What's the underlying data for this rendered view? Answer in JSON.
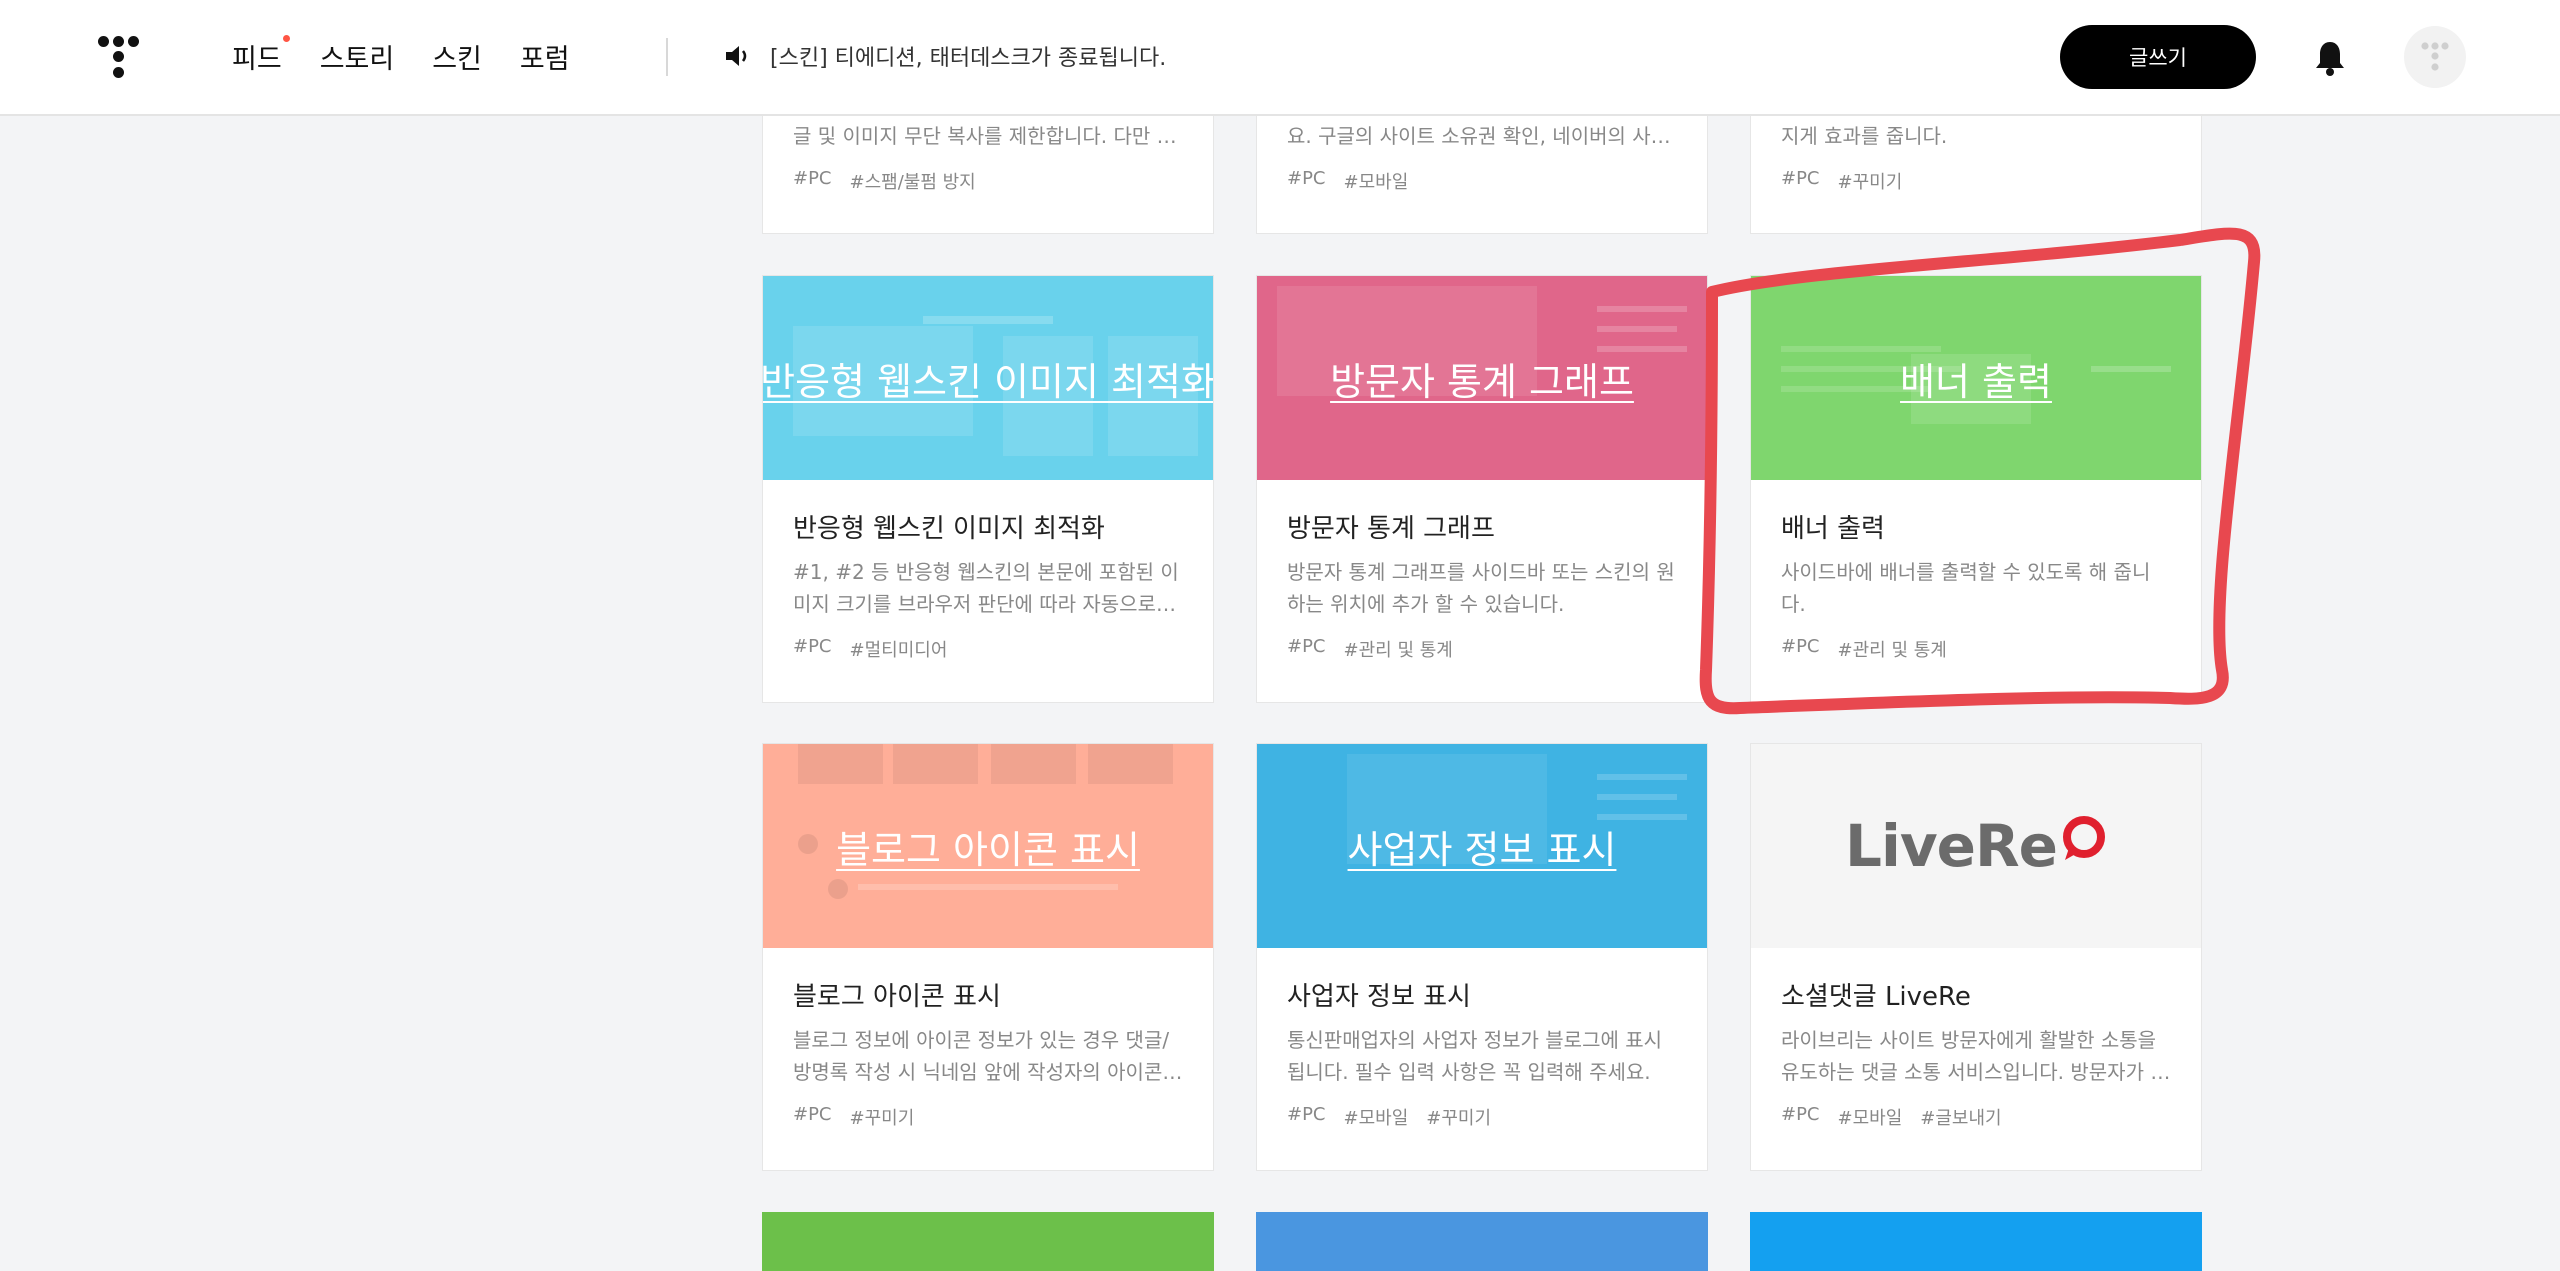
{
  "header": {
    "nav": [
      {
        "label": "피드",
        "has_dot": true
      },
      {
        "label": "스토리"
      },
      {
        "label": "스킨"
      },
      {
        "label": "포럼"
      }
    ],
    "notice": "[스킨] 티에디션, 태터데스크가 종료됩니다.",
    "write_button": "글쓰기"
  },
  "top_partial_cards": [
    {
      "desc": "글 및 이미지 무단 복사를 제한합니다. 다만 …",
      "tags": [
        "#PC",
        "#스팸/불펌 방지"
      ]
    },
    {
      "desc": "요. 구글의 사이트 소유권 확인, 네이버의 사…",
      "tags": [
        "#PC",
        "#모바일"
      ]
    },
    {
      "desc": "지게 효과를 줍니다.",
      "tags": [
        "#PC",
        "#꾸미기"
      ]
    }
  ],
  "cards_row1": [
    {
      "thumb_title": "반응형 웹스킨 이미지 최적화",
      "title": "반응형 웹스킨 이미지 최적화",
      "desc": "#1, #2 등 반응형 웹스킨의 본문에 포함된 이미지 크기를 브라우저 판단에 따라 자동으로 조…",
      "tags": [
        "#PC",
        "#멀티미디어"
      ],
      "color": "#69d2ec"
    },
    {
      "thumb_title": "방문자 통계 그래프",
      "title": "방문자 통계 그래프",
      "desc": "방문자 통계 그래프를 사이드바 또는 스킨의 원하는 위치에 추가 할 수 있습니다.",
      "tags": [
        "#PC",
        "#관리 및 통계"
      ],
      "color": "#e0668a"
    },
    {
      "thumb_title": "배너 출력",
      "title": "배너 출력",
      "desc": "사이드바에 배너를 출력할 수 있도록 해 줍니다.",
      "tags": [
        "#PC",
        "#관리 및 통계"
      ],
      "color": "#7fd66e"
    }
  ],
  "cards_row2": [
    {
      "thumb_title": "블로그 아이콘 표시",
      "title": "블로그 아이콘 표시",
      "desc": "블로그 정보에 아이콘 정보가 있는 경우 댓글/방명록 작성 시 닉네임 앞에 작성자의 아이콘…",
      "tags": [
        "#PC",
        "#꾸미기"
      ],
      "color": "#ffae98"
    },
    {
      "thumb_title": "사업자 정보 표시",
      "title": "사업자 정보 표시",
      "desc": "통신판매업자의 사업자 정보가 블로그에 표시됩니다. 필수 입력 사항은 꼭 입력해 주세요.",
      "tags": [
        "#PC",
        "#모바일",
        "#꾸미기"
      ],
      "color": "#3fb3e3"
    },
    {
      "logo_text": "LiveRe",
      "title": "소셜댓글 LiveRe",
      "desc": "라이브리는 사이트 방문자에게 활발한 소통을 유도하는 댓글 소통 서비스입니다. 방문자가 …",
      "tags": [
        "#PC",
        "#모바일",
        "#글보내기"
      ],
      "color": "#f5f5f5"
    }
  ],
  "bottom_partial_colors": [
    "#6cc04a",
    "#4a96e0",
    "#14a0f0"
  ],
  "annotation_color": "#e8484f"
}
